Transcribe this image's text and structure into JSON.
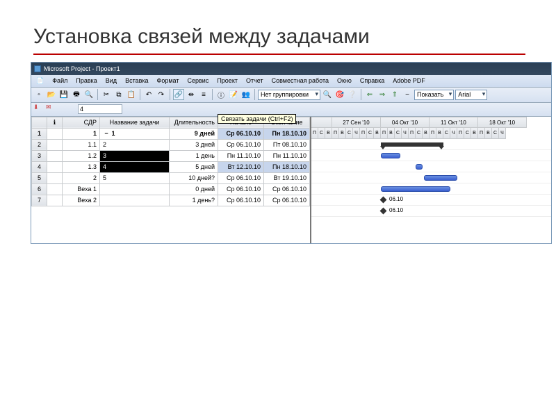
{
  "slide": {
    "title": "Установка связей между задачами"
  },
  "app": {
    "title": "Microsoft Project - Проект1",
    "menu": [
      "Файл",
      "Правка",
      "Вид",
      "Вставка",
      "Формат",
      "Сервис",
      "Проект",
      "Отчет",
      "Совместная работа",
      "Окно",
      "Справка",
      "Adobe PDF"
    ],
    "tooltip": "Связать задачи (Ctrl+F2)",
    "grouping": "Нет группировки",
    "show_label": "Показать",
    "font": "Arial",
    "fx_value": "4"
  },
  "columns": {
    "info": "",
    "wbs": "СДР",
    "name": "Название задачи",
    "duration": "Длительность",
    "start": "Начало",
    "finish": "Окончание"
  },
  "rows": [
    {
      "n": "1",
      "wbs": "1",
      "name": "1",
      "dur": "9 дней",
      "start": "Ср 06.10.10",
      "end": "Пн 18.10.10",
      "summary": true,
      "outline": "−"
    },
    {
      "n": "2",
      "wbs": "1.1",
      "name": "2",
      "dur": "3 дней",
      "start": "Ср 06.10.10",
      "end": "Пт 08.10.10"
    },
    {
      "n": "3",
      "wbs": "1.2",
      "name": "3",
      "dur": "1 день",
      "start": "Пн 11.10.10",
      "end": "Пн 11.10.10",
      "sel": true
    },
    {
      "n": "4",
      "wbs": "1.3",
      "name": "4",
      "dur": "5 дней",
      "start": "Вт 12.10.10",
      "end": "Пн 18.10.10",
      "sel": true,
      "sel2": true
    },
    {
      "n": "5",
      "wbs": "2",
      "name": "5",
      "dur": "10 дней?",
      "start": "Ср 06.10.10",
      "end": "Вт 19.10.10"
    },
    {
      "n": "6",
      "wbs": "Веха 1",
      "name": "",
      "dur": "0 дней",
      "start": "Ср 06.10.10",
      "end": "Ср 06.10.10"
    },
    {
      "n": "7",
      "wbs": "Веха 2",
      "name": "",
      "dur": "1 день?",
      "start": "Ср 06.10.10",
      "end": "Ср 06.10.10"
    }
  ],
  "timescale": {
    "weeks": [
      "",
      "27 Сен '10",
      "04 Окт '10",
      "11 Окт '10",
      "18 Окт '10"
    ],
    "days": "ПСВПВСЧПСВПВСЧПСВПВСЧПСВПВСЧ"
  },
  "milestones": {
    "label": "06.10"
  }
}
